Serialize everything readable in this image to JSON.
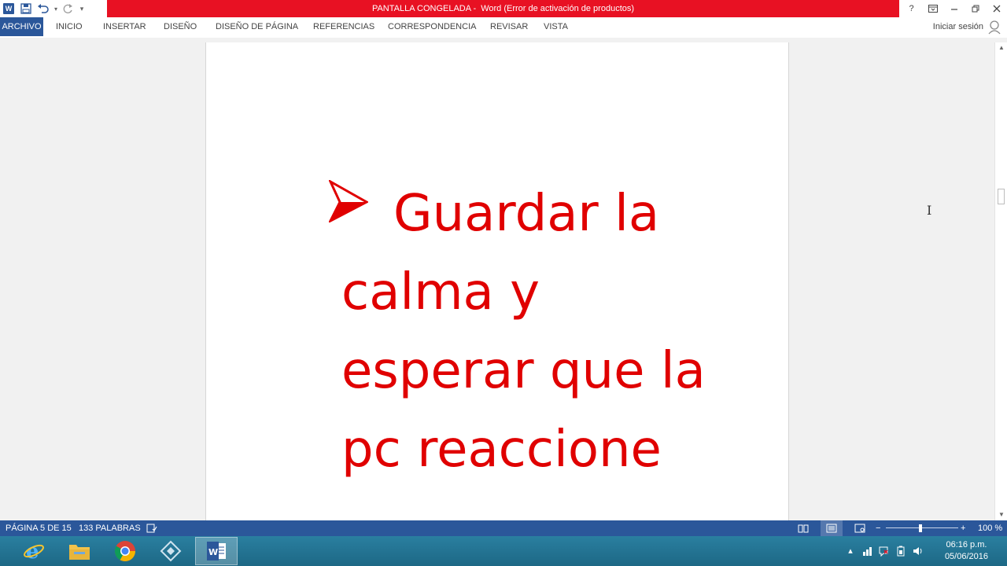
{
  "window": {
    "doc_name": "PANTALLA CONGELADA -",
    "app_title": "Word (Error de activación de productos)",
    "help_label": "?",
    "qat_customize": "▾"
  },
  "ribbon": {
    "tabs": [
      {
        "label": "ARCHIVO"
      },
      {
        "label": "INICIO"
      },
      {
        "label": "INSERTAR"
      },
      {
        "label": "DISEÑO"
      },
      {
        "label": "DISEÑO DE PÁGINA"
      },
      {
        "label": "REFERENCIAS"
      },
      {
        "label": "CORRESPONDENCIA"
      },
      {
        "label": "REVISAR"
      },
      {
        "label": "VISTA"
      }
    ],
    "signin_label": "Iniciar sesión"
  },
  "document": {
    "line1": "Guardar la",
    "line2": "calma y",
    "line3": "esperar que la",
    "line4": "pc reaccione",
    "text_color": "#e00000"
  },
  "statusbar": {
    "page_info": "PÁGINA 5 DE 15",
    "word_count": "133 PALABRAS",
    "zoom_minus": "−",
    "zoom_plus": "+",
    "zoom_level": "100 %"
  },
  "taskbar": {
    "apps": [
      "internet-explorer-icon",
      "file-explorer-icon",
      "chrome-icon",
      "remote-desktop-icon",
      "word-icon"
    ],
    "time": "06:16 p.m.",
    "date": "05/06/2016"
  },
  "colors": {
    "accent": "#2b579a",
    "title_strip": "#e81123"
  }
}
